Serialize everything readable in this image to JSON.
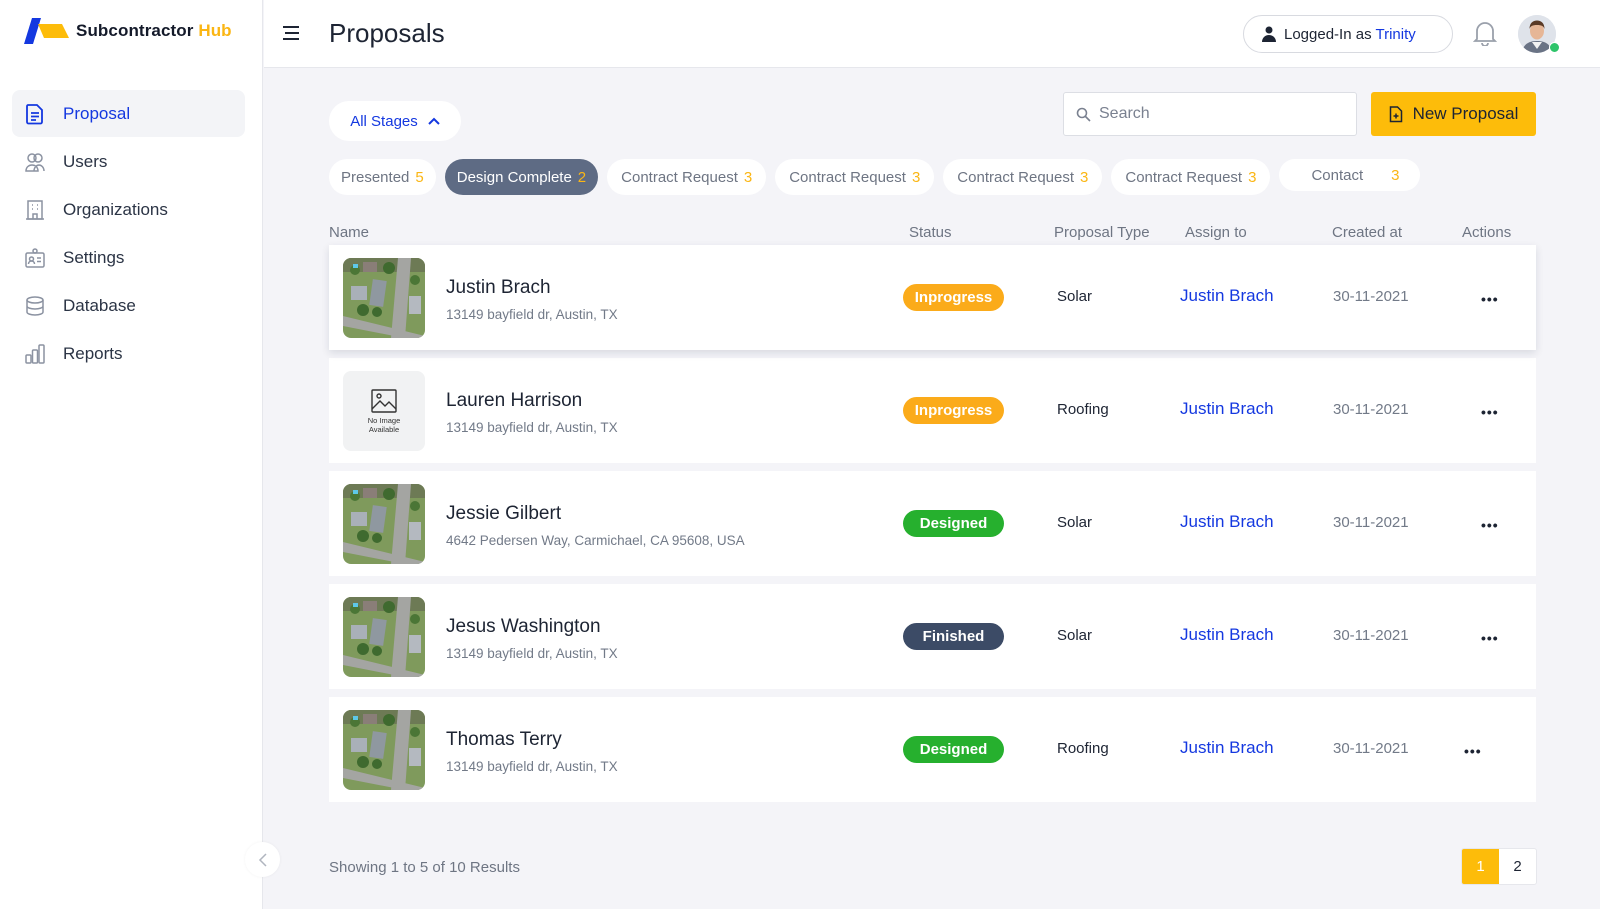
{
  "brand": {
    "name_main": "Subcontractor",
    "name_accent": "Hub",
    "accent_color": "#fbb614",
    "primary_color": "#1438e0"
  },
  "sidebar": {
    "items": [
      {
        "label": "Proposal",
        "icon": "document-icon",
        "active": true
      },
      {
        "label": "Users",
        "icon": "users-icon",
        "active": false
      },
      {
        "label": "Organizations",
        "icon": "building-icon",
        "active": false
      },
      {
        "label": "Settings",
        "icon": "id-badge-icon",
        "active": false
      },
      {
        "label": "Database",
        "icon": "database-icon",
        "active": false
      },
      {
        "label": "Reports",
        "icon": "bar-chart-icon",
        "active": false
      }
    ]
  },
  "header": {
    "title": "Proposals",
    "login_prefix": "Logged-In as",
    "login_user": "Trinity"
  },
  "toolbar": {
    "stage_filter": "All Stages",
    "search_placeholder": "Search",
    "search_value": "",
    "new_button": "New Proposal"
  },
  "stages": [
    {
      "label": "Presented",
      "count": "5",
      "active": false
    },
    {
      "label": "Design Complete",
      "count": "2",
      "active": true
    },
    {
      "label": "Contract Request",
      "count": "3",
      "active": false
    },
    {
      "label": "Contract Request",
      "count": "3",
      "active": false
    },
    {
      "label": "Contract Request",
      "count": "3",
      "active": false
    },
    {
      "label": "Contract Request",
      "count": "3",
      "active": false
    },
    {
      "label": "Contact",
      "count": "3",
      "active": false
    }
  ],
  "table": {
    "columns": [
      "Name",
      "Status",
      "Proposal Type",
      "Assign to",
      "Created at",
      "Actions"
    ],
    "rows": [
      {
        "name": "Justin Brach",
        "address": "13149 bayfield dr, Austin, TX",
        "image": "aerial",
        "status": "Inprogress",
        "status_color": "#fbab1a",
        "type": "Solar",
        "assign": "Justin Brach",
        "created": "30-11-2021",
        "actions": "•••"
      },
      {
        "name": "Lauren Harrison",
        "address": "13149 bayfield dr, Austin, TX",
        "image": "none",
        "status": "Inprogress",
        "status_color": "#fbab1a",
        "type": "Roofing",
        "assign": "Justin Brach",
        "created": "30-11-2021",
        "actions": "•••"
      },
      {
        "name": "Jessie Gilbert",
        "address": "4642 Pedersen Way, Carmichael, CA 95608, USA",
        "image": "aerial",
        "status": "Designed",
        "status_color": "#26b02e",
        "type": "Solar",
        "assign": "Justin Brach",
        "created": "30-11-2021",
        "actions": "•••"
      },
      {
        "name": "Jesus Washington",
        "address": "13149 bayfield dr, Austin, TX",
        "image": "aerial",
        "status": "Finished",
        "status_color": "#3c4b66",
        "type": "Solar",
        "assign": "Justin Brach",
        "created": "30-11-2021",
        "actions": "•••"
      },
      {
        "name": "Thomas Terry",
        "address": "13149 bayfield dr, Austin, TX",
        "image": "aerial",
        "status": "Designed",
        "status_color": "#26b02e",
        "type": "Roofing",
        "assign": "Justin Brach",
        "created": "30-11-2021",
        "actions": "•••"
      }
    ],
    "no_image_text": [
      "No Image",
      "Available"
    ]
  },
  "footer": {
    "showing": "Showing 1 to 5 of 10 Results",
    "pages": [
      "1",
      "2"
    ],
    "current_page": "1"
  }
}
